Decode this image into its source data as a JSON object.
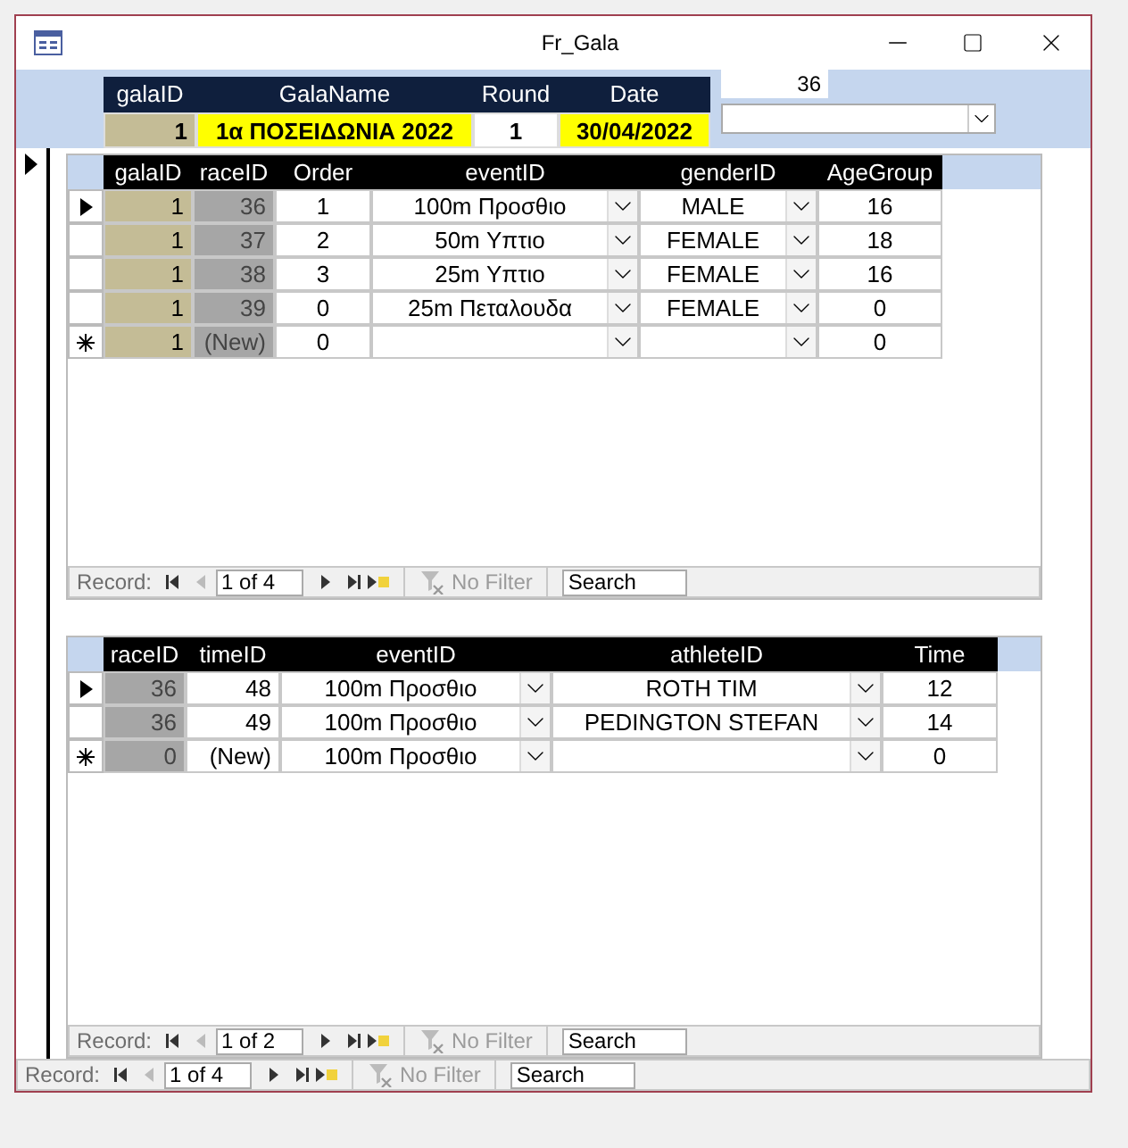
{
  "window": {
    "title": "Fr_Gala"
  },
  "header": {
    "fields": [
      {
        "label": "galaID",
        "value": "1",
        "kind": "locked"
      },
      {
        "label": "GalaName",
        "value": "1α ΠΟΣΕΙΔΩΝΙΑ 2022",
        "kind": "highlight"
      },
      {
        "label": "Round",
        "value": "1",
        "kind": "plain"
      },
      {
        "label": "Date",
        "value": "30/04/2022",
        "kind": "highlight"
      }
    ],
    "side_textbox": {
      "value": "36"
    }
  },
  "subform_1": {
    "columns": [
      {
        "label": "galaID",
        "kind": "locked"
      },
      {
        "label": "raceID",
        "kind": "key"
      },
      {
        "label": "Order",
        "kind": "text"
      },
      {
        "label": "eventID",
        "kind": "combo"
      },
      {
        "label": "genderID",
        "kind": "combo"
      },
      {
        "label": "AgeGroup",
        "kind": "text"
      }
    ],
    "rows": [
      {
        "kind": "record",
        "selected": true,
        "cells": [
          "1",
          "36",
          "1",
          "100m  Προσθιο",
          "MALE",
          "16"
        ]
      },
      {
        "kind": "record",
        "selected": false,
        "cells": [
          "1",
          "37",
          "2",
          "50m  Υπτιο",
          "FEMALE",
          "18"
        ]
      },
      {
        "kind": "record",
        "selected": false,
        "cells": [
          "1",
          "38",
          "3",
          "25m  Υπτιο",
          "FEMALE",
          "16"
        ]
      },
      {
        "kind": "record",
        "selected": false,
        "cells": [
          "1",
          "39",
          "0",
          "25m  Πεταλουδα",
          "FEMALE",
          "0"
        ]
      },
      {
        "kind": "new",
        "selected": false,
        "cells": [
          "1",
          "(New)",
          "0",
          "",
          "",
          "0"
        ]
      }
    ],
    "navigation": {
      "label": "Record:",
      "position": "1 of 4",
      "filter": "No Filter",
      "search": "Search"
    }
  },
  "subform_2": {
    "columns": [
      {
        "label": "raceID",
        "kind": "key"
      },
      {
        "label": "timeID",
        "kind": "number"
      },
      {
        "label": "eventID",
        "kind": "combo"
      },
      {
        "label": "athleteID",
        "kind": "combo"
      },
      {
        "label": "Time",
        "kind": "text"
      }
    ],
    "rows": [
      {
        "kind": "record",
        "selected": true,
        "cells": [
          "36",
          "48",
          "100m  Προσθιο",
          "ROTH TIM",
          "12"
        ]
      },
      {
        "kind": "record",
        "selected": false,
        "cells": [
          "36",
          "49",
          "100m  Προσθιο",
          "PEDINGTON STEFAN",
          "14"
        ]
      },
      {
        "kind": "new",
        "selected": false,
        "cells": [
          "0",
          "(New)",
          "100m  Προσθιο",
          "",
          "0"
        ]
      }
    ],
    "navigation": {
      "label": "Record:",
      "position": "1 of 2",
      "filter": "No Filter",
      "search": "Search"
    }
  },
  "navigation": {
    "label": "Record:",
    "position": "1 of 4",
    "filter": "No Filter",
    "search": "Search"
  }
}
